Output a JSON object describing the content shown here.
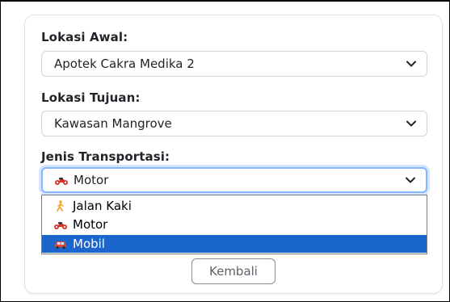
{
  "form": {
    "origin_label": "Lokasi Awal:",
    "origin_value": "Apotek Cakra Medika 2",
    "destination_label": "Lokasi Tujuan:",
    "destination_value": "Kawasan Mangrove",
    "transport_label": "Jenis Transportasi:",
    "transport_value": "Motor",
    "transport_icon": "motorcycle-icon"
  },
  "transport_options": [
    {
      "label": "Jalan Kaki",
      "icon": "walking-person-icon",
      "selected": false
    },
    {
      "label": "Motor",
      "icon": "motorcycle-icon",
      "selected": false
    },
    {
      "label": "Mobil",
      "icon": "car-icon",
      "selected": true
    }
  ],
  "actions": {
    "back_label": "Kembali"
  },
  "colors": {
    "highlight": "#1a66cc",
    "focus_ring": "#86b7fe",
    "icon_red": "#d93025",
    "walker_orange": "#f2a53a"
  }
}
